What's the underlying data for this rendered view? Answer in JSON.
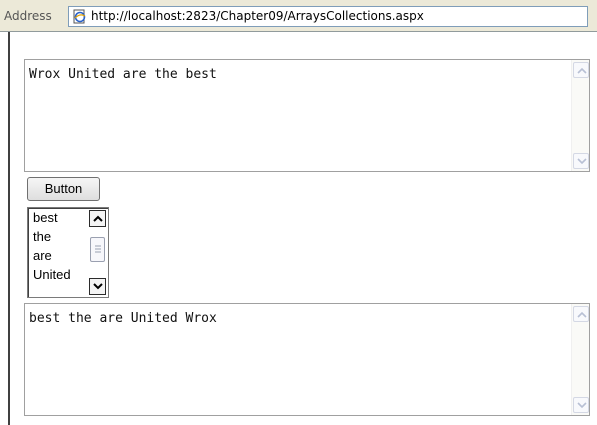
{
  "address_bar": {
    "label": "Address",
    "url": "http://localhost:2823/Chapter09/ArraysCollections.aspx"
  },
  "page": {
    "input_text": "Wrox United are the best",
    "button_label": "Button",
    "listbox_items": [
      "best",
      "the",
      "are",
      "United"
    ],
    "output_text": "best the are United Wrox"
  },
  "icons": {
    "page": "ie-page-icon",
    "scroll_up": "chevron-up-icon",
    "scroll_down": "chevron-down-icon",
    "thumb_grip": "grip-icon"
  }
}
